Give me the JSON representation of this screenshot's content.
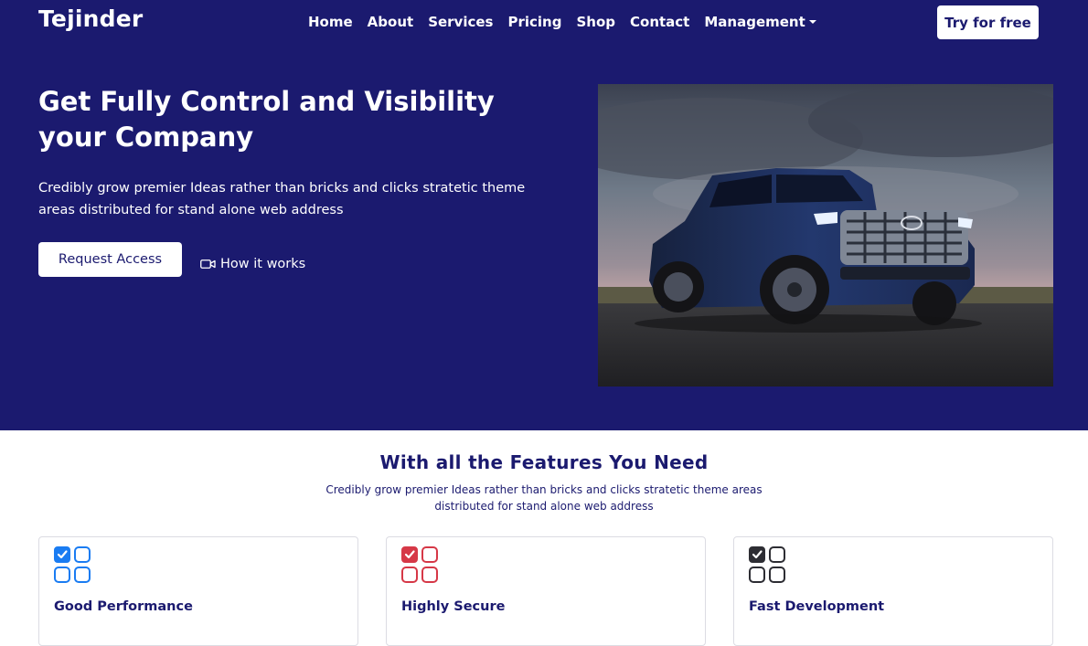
{
  "brand": "Tejinder",
  "nav": {
    "items": [
      {
        "label": "Home"
      },
      {
        "label": "About"
      },
      {
        "label": "Services"
      },
      {
        "label": "Pricing"
      },
      {
        "label": "Shop"
      },
      {
        "label": "Contact"
      },
      {
        "label": "Management"
      }
    ],
    "cta": "Try for free"
  },
  "hero": {
    "title": "Get Fully Control and Visibility your Company",
    "description": "Credibly grow premier Ideas rather than bricks and clicks stratetic theme areas distributed for stand alone web address",
    "primary_button": "Request Access",
    "secondary_link": "How it works",
    "secondary_icon": "video-icon",
    "image": "pickup-truck-photo"
  },
  "features": {
    "title": "With all the Features You Need",
    "description": "Credibly grow premier Ideas rather than bricks and clicks stratetic theme areas distributed for stand alone web address",
    "cards": [
      {
        "title": "Good Performance",
        "icon": "checklist-icon",
        "color": "#1a7cf2"
      },
      {
        "title": "Highly Secure",
        "icon": "checklist-icon",
        "color": "#d63847"
      },
      {
        "title": "Fast Development",
        "icon": "checklist-icon",
        "color": "#2d2d33"
      }
    ]
  },
  "colors": {
    "primary": "#1b1a6f",
    "white": "#ffffff"
  }
}
